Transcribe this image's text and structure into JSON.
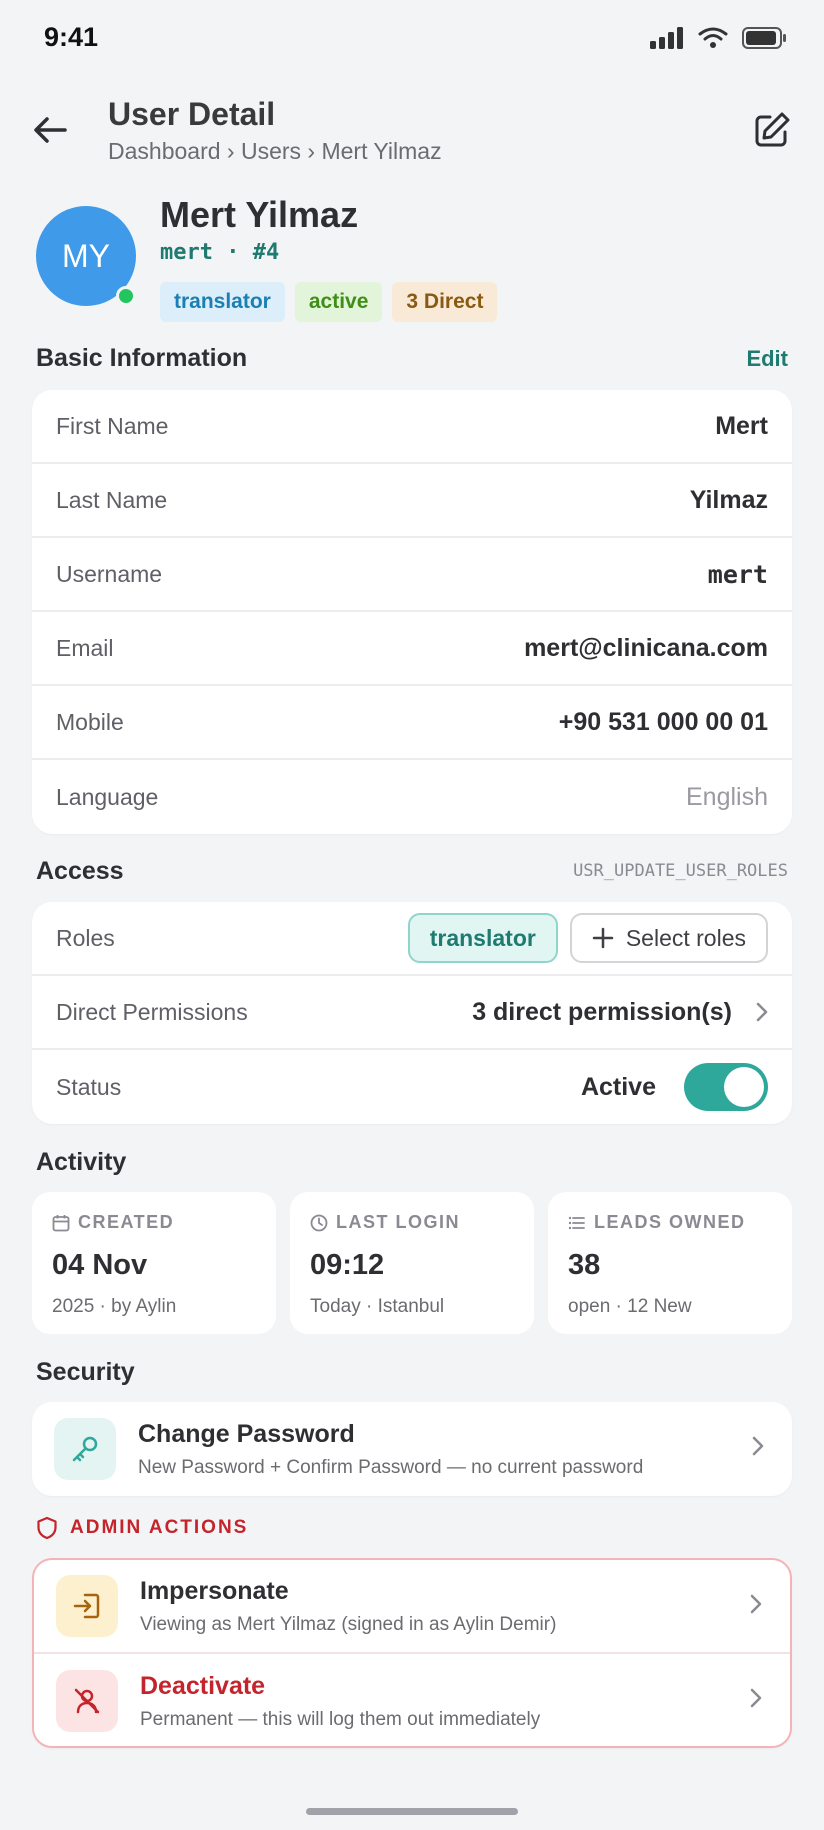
{
  "status_bar": {
    "time": "9:41"
  },
  "header": {
    "title": "User Detail",
    "breadcrumb": "Dashboard › Users › Mert Yilmaz"
  },
  "profile": {
    "initials": "MY",
    "name": "Mert Yilmaz",
    "handle": "mert · #4",
    "badges": [
      {
        "label": "translator",
        "color": "#1b7fb3",
        "bg": "#dbeefa"
      },
      {
        "label": "active",
        "color": "#3f8f16",
        "bg": "#e2f4d9"
      },
      {
        "label": "3 Direct",
        "color": "#8a5a12",
        "bg": "#f8ead6"
      }
    ]
  },
  "basic_info": {
    "title": "Basic Information",
    "edit_label": "Edit",
    "rows": [
      {
        "label": "First Name",
        "value": "Mert"
      },
      {
        "label": "Last Name",
        "value": "Yilmaz"
      },
      {
        "label": "Username",
        "value": "mert"
      },
      {
        "label": "Email",
        "value": "mert@clinicana.com"
      },
      {
        "label": "Mobile",
        "value": "+90 531 000 00 01"
      },
      {
        "label": "Language",
        "value": "English"
      }
    ]
  },
  "access": {
    "title": "Access",
    "permission_code": "USR_UPDATE_USER_ROLES",
    "roles_label": "Roles",
    "role_chip": "translator",
    "select_roles": "Select roles",
    "direct_label": "Direct Permissions",
    "direct_value": "3 direct permission(s)",
    "status_label": "Status",
    "status_value": "Active",
    "status_on": true
  },
  "activity": {
    "title": "Activity",
    "cards": [
      {
        "caption": "CREATED",
        "big": "04 Nov",
        "small": "2025 · by Aylin"
      },
      {
        "caption": "LAST LOGIN",
        "big": "09:12",
        "small": "Today · Istanbul"
      },
      {
        "caption": "LEADS OWNED",
        "big": "38",
        "small": "open · 12 New"
      }
    ]
  },
  "security": {
    "title": "Security",
    "change_password_title": "Change Password",
    "change_password_desc": "New Password + Confirm Password — no current password"
  },
  "admin": {
    "title": "ADMIN ACTIONS",
    "impersonate_title": "Impersonate",
    "impersonate_desc": "Viewing as Mert Yilmaz (signed in as Aylin Demir)",
    "deactivate_title": "Deactivate",
    "deactivate_desc": "Permanent — this will log them out immediately"
  },
  "colors": {
    "accent": "#2fa89c",
    "danger": "#c4242b",
    "avatar": "#3f9bea"
  }
}
